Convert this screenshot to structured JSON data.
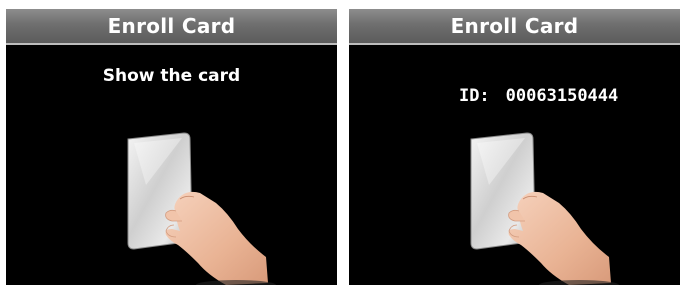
{
  "left_screen": {
    "title": "Enroll Card",
    "prompt": "Show the card"
  },
  "right_screen": {
    "title": "Enroll Card",
    "id_label": "ID:",
    "id_value": "00063150444"
  },
  "colors": {
    "screen_background": "#000000",
    "title_bar": "#6f6f6f",
    "text": "#ffffff"
  },
  "icons": {
    "illustration": "hand-holding-card-icon"
  }
}
